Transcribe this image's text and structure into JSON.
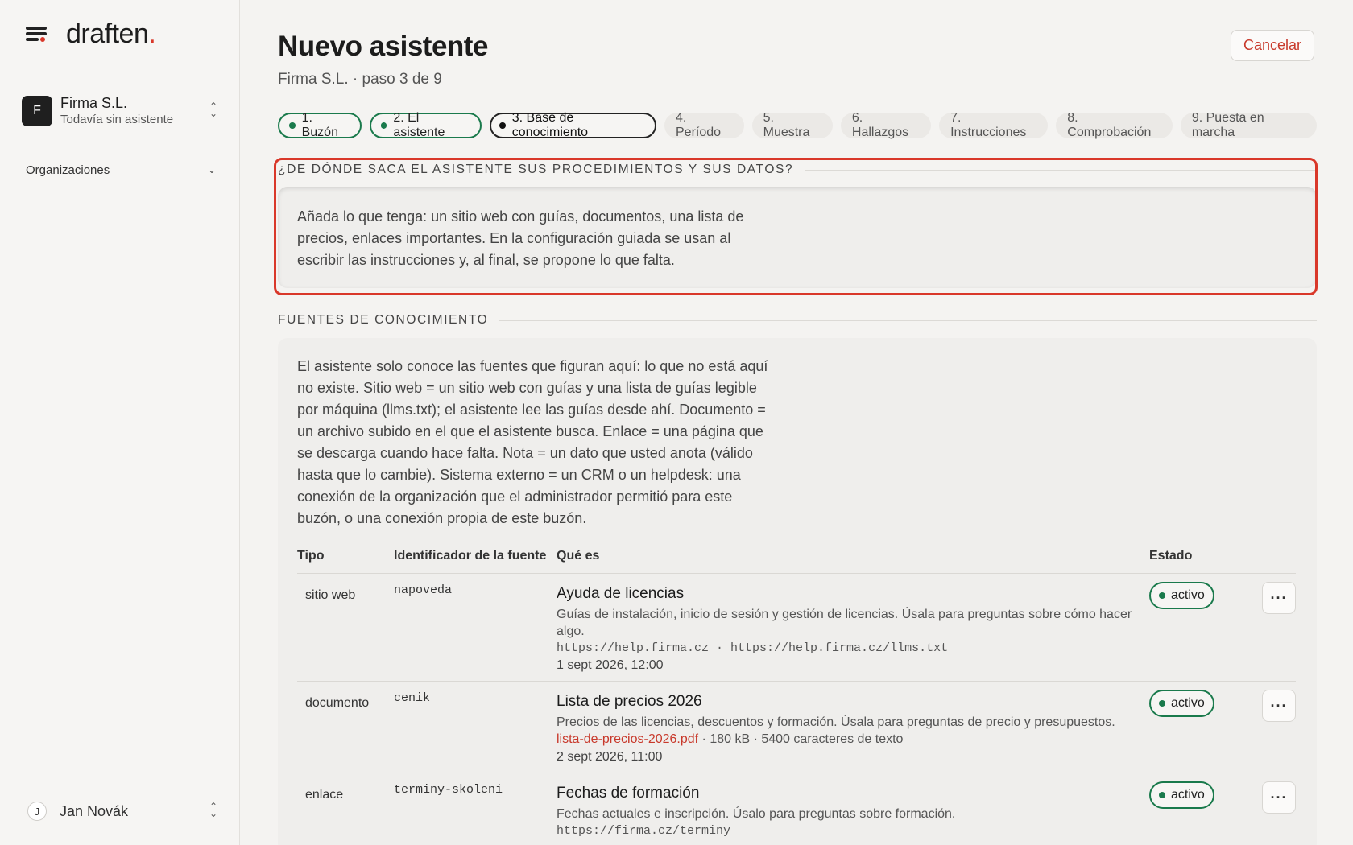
{
  "brand": {
    "logo_text": "draften",
    "logo_dot": "."
  },
  "org": {
    "avatar": "F",
    "name": "Firma S.L.",
    "subtitle": "Todavía sin asistente"
  },
  "sidebar": {
    "organizations_label": "Organizaciones"
  },
  "user": {
    "avatar": "J",
    "name": "Jan Novák"
  },
  "header": {
    "title": "Nuevo asistente",
    "subtitle": "Firma S.L. · paso 3 de 9",
    "cancel_label": "Cancelar"
  },
  "steps": [
    {
      "label": "1. Buzón",
      "state": "done"
    },
    {
      "label": "2. El asistente",
      "state": "done"
    },
    {
      "label": "3. Base de conocimiento",
      "state": "current"
    },
    {
      "label": "4. Período",
      "state": "todo"
    },
    {
      "label": "5. Muestra",
      "state": "todo"
    },
    {
      "label": "6. Hallazgos",
      "state": "todo"
    },
    {
      "label": "7. Instrucciones",
      "state": "todo"
    },
    {
      "label": "8. Comprobación",
      "state": "todo"
    },
    {
      "label": "9. Puesta en marcha",
      "state": "todo"
    }
  ],
  "section1": {
    "heading": "¿DE DÓNDE SACA EL ASISTENTE SUS PROCEDIMIENTOS Y SUS DATOS?",
    "text": "Añada lo que tenga: un sitio web con guías, documentos, una lista de precios, enlaces importantes. En la configuración guiada se usan al escribir las instrucciones y, al final, se propone lo que falta."
  },
  "section2": {
    "heading": "FUENTES DE CONOCIMIENTO",
    "text": "El asistente solo conoce las fuentes que figuran aquí: lo que no está aquí no existe. Sitio web = un sitio web con guías y una lista de guías legible por máquina (llms.txt); el asistente lee las guías desde ahí. Documento = un archivo subido en el que el asistente busca. Enlace = una página que se descarga cuando hace falta. Nota = un dato que usted anota (válido hasta que lo cambie). Sistema externo = un CRM o un helpdesk: una conexión de la organización que el administrador permitió para este buzón, o una conexión propia de este buzón."
  },
  "table": {
    "headers": {
      "type": "Tipo",
      "ident": "Identificador de la fuente",
      "what": "Qué es",
      "status": "Estado"
    },
    "rows": [
      {
        "type": "sitio web",
        "ident": "napoveda",
        "title": "Ayuda de licencias",
        "desc": "Guías de instalación, inicio de sesión y gestión de licencias. Úsala para preguntas sobre cómo hacer algo.",
        "meta": "https://help.firma.cz · https://help.firma.cz/llms.txt",
        "date": "1 sept 2026, 12:00",
        "status": "activo"
      },
      {
        "type": "documento",
        "ident": "cenik",
        "title": "Lista de precios 2026",
        "desc": "Precios de las licencias, descuentos y formación. Úsala para preguntas de precio y presupuestos.",
        "file_link": "lista-de-precios-2026.pdf",
        "file_info": " · 180 kB · 5400 caracteres de texto",
        "date": "2 sept 2026, 11:00",
        "status": "activo"
      },
      {
        "type": "enlace",
        "ident": "terminy-skoleni",
        "title": "Fechas de formación",
        "desc": "Fechas actuales e inscripción. Úsalo para preguntas sobre formación.",
        "meta": "https://firma.cz/terminy",
        "status": "activo"
      }
    ],
    "more_label": "···"
  },
  "colors": {
    "accent": "#d9382a",
    "success": "#1a7a4c",
    "background": "#f4f3f1"
  }
}
